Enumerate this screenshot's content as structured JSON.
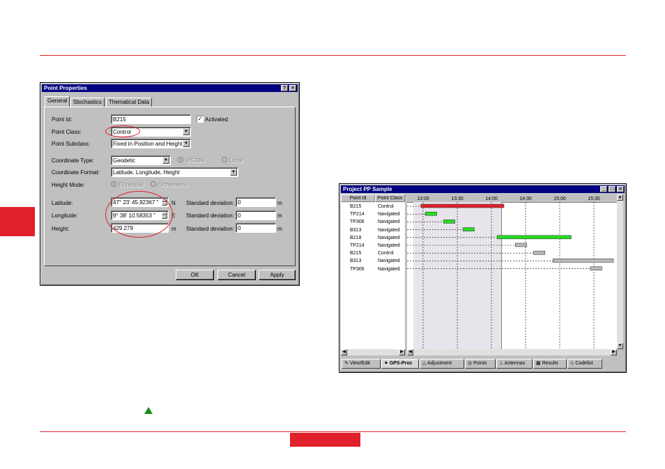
{
  "dialog": {
    "title": "Point Properties",
    "tabs": [
      "General",
      "Stochastics",
      "Thematical Data"
    ],
    "point_id_label": "Point Id:",
    "point_id_value": "B215",
    "activated_label": "Activated",
    "point_class_label": "Point Class:",
    "point_class_value": "Control",
    "point_subclass_label": "Point Subclass:",
    "point_subclass_value": "Fixed in Position and Height",
    "coord_type_label": "Coordinate Type:",
    "coord_type_value": "Geodetic",
    "wgs84_label": "WGS84",
    "local_label": "Local",
    "coord_format_label": "Coordinate Format:",
    "coord_format_value": "Latitude, Longitude, Height",
    "height_mode_label": "Height Mode:",
    "ellipsoidal_label": "Ellipsoidal",
    "orthometric_label": "Orthometric",
    "latitude_label": "Latitude:",
    "latitude_value": "47° 23' 45.92367 \"",
    "latitude_dir": "N",
    "longitude_label": "Longitude:",
    "longitude_value": "9° 38' 10.58353 \"",
    "longitude_dir": "E",
    "height_label": "Height:",
    "height_value": "429.279",
    "height_unit": "m",
    "std_label": "Standard deviation:",
    "std_values": [
      "0",
      "0",
      "0"
    ],
    "std_unit": "m",
    "ok_label": "OK",
    "cancel_label": "Cancel",
    "apply_label": "Apply"
  },
  "project": {
    "title": "Project PP Sample",
    "col_point_id": "Point Id",
    "col_point_class": "Point Class",
    "times": [
      "13:00",
      "13:30",
      "14:00",
      "14:30",
      "15:00",
      "15:30"
    ],
    "rows": [
      {
        "id": "B215",
        "cls": "Control"
      },
      {
        "id": "TP214",
        "cls": "Navigated"
      },
      {
        "id": "TP306",
        "cls": "Navigated"
      },
      {
        "id": "B313",
        "cls": "Navigated"
      },
      {
        "id": "B218",
        "cls": "Navigated"
      },
      {
        "id": "TP214",
        "cls": "Navigated"
      },
      {
        "id": "B215",
        "cls": "Control"
      },
      {
        "id": "B313",
        "cls": "Navigated"
      },
      {
        "id": "TP306",
        "cls": "Navigated"
      }
    ],
    "bottom_tabs": [
      "View/Edit",
      "GPS-Proc",
      "Adjustment",
      "Points",
      "Antennas",
      "Results",
      "Codelist"
    ],
    "colors": {
      "control": "#e0202a",
      "green": "#22dd22",
      "gray": "#b8b8b8"
    }
  }
}
